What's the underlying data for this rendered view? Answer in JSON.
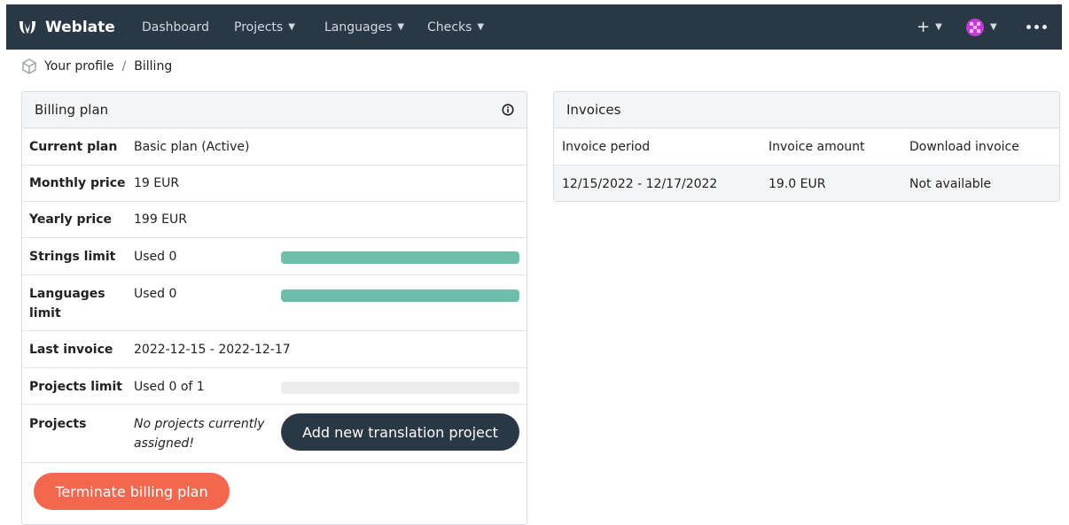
{
  "navbar": {
    "brand": "Weblate",
    "links": [
      {
        "label": "Dashboard"
      },
      {
        "label": "Projects"
      },
      {
        "label": "Languages"
      },
      {
        "label": "Checks"
      }
    ],
    "plus": "+"
  },
  "breadcrumb": {
    "profile": "Your profile",
    "separator": "/",
    "current": "Billing"
  },
  "billing": {
    "heading": "Billing plan",
    "rows": {
      "current_plan": {
        "label": "Current plan",
        "value": "Basic plan (Active)"
      },
      "monthly_price": {
        "label": "Monthly price",
        "value": "19 EUR"
      },
      "yearly_price": {
        "label": "Yearly price",
        "value": "199 EUR"
      },
      "strings_limit": {
        "label": "Strings limit",
        "value": "Used 0",
        "progress_percent": 100
      },
      "languages_limit": {
        "label": "Languages limit",
        "value": "Used 0",
        "progress_percent": 100
      },
      "last_invoice": {
        "label": "Last invoice",
        "value": "2022-12-15 - 2022-12-17"
      },
      "projects_limit": {
        "label": "Projects limit",
        "value": "Used 0 of 1",
        "progress_percent": 0
      },
      "projects": {
        "label": "Projects",
        "value": "No projects currently assigned!",
        "button": "Add new translation project"
      }
    },
    "terminate_button": "Terminate billing plan"
  },
  "invoices": {
    "heading": "Invoices",
    "columns": [
      "Invoice period",
      "Invoice amount",
      "Download invoice"
    ],
    "rows": [
      [
        "12/15/2022 - 12/17/2022",
        "19.0 EUR",
        "Not available"
      ]
    ]
  },
  "colors": {
    "navbar": "#2a3744",
    "progress": "#6dbfab",
    "danger": "#f2674e"
  }
}
